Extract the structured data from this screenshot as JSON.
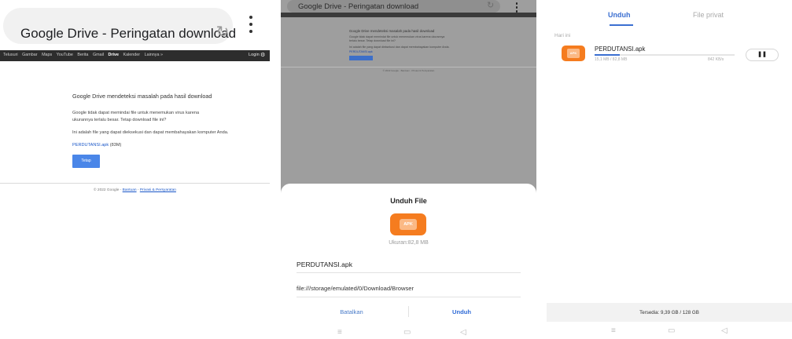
{
  "panel1": {
    "url_title": "Google Drive - Peringatan download",
    "nav_links": [
      "Telusuri",
      "Gambar",
      "Maps",
      "YouTube",
      "Berita",
      "Gmail",
      "Drive",
      "Kalender",
      "Lainnya »"
    ],
    "nav_active": "Drive",
    "login": "Login",
    "warning_title": "Google Drive mendeteksi masalah pada hasil download",
    "warning_body": "Google tidak dapat memindai file untuk menemukan virus karena ukurannya terlalu besar. Tetap download file ini?",
    "warning_exe": "Ini adalah file yang dapat dieksekusi dan dapat membahayakan komputer Anda.",
    "file_link": "PERDUTANSI.apk",
    "file_size": "(83M)",
    "download_button": "Tetap download",
    "footer_copy": "© 2022 Google -",
    "footer_links": [
      "Bantuan",
      "Privasi & Persyaratan"
    ]
  },
  "panel2": {
    "url_title": "Google Drive - Peringatan download",
    "sheet_title": "Unduh File",
    "apk_label": "APK",
    "size_text": "Ukuran:82,8 MB",
    "file_name": "PERDUTANSI.apk",
    "file_path": "file:///storage/emulated/0/Download/Browser",
    "cancel_button": "Batalkan",
    "download_button": "Unduh"
  },
  "panel3": {
    "tab_download": "Unduh",
    "tab_private": "File privat",
    "section_label": "Hari ini",
    "apk_label": "APK",
    "item_name": "PERDUTANSI.apk",
    "item_size": "15,1 MB / 82,8 MB",
    "item_speed": "842 KB/s",
    "progress_fraction": 0.18,
    "pause_icon": "pause-icon",
    "storage_text": "Tersedia: 9,39 GB / 128 GB"
  },
  "colors": {
    "accent_blue": "#3b6fd1",
    "apk_orange": "#f57c1f",
    "google_bar": "#2d2d2d"
  }
}
